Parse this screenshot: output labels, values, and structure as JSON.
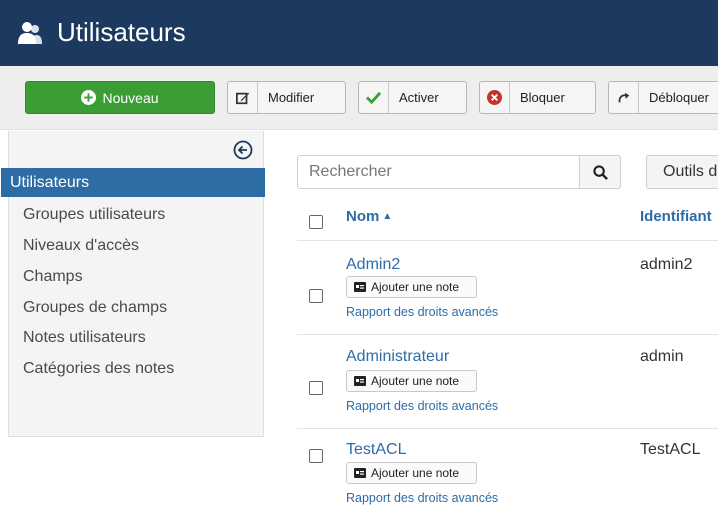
{
  "header": {
    "title": "Utilisateurs",
    "icon": "users-icon",
    "bg_color": "#1c3a5f"
  },
  "toolbar": {
    "new_label": "Nouveau",
    "edit_label": "Modifier",
    "activate_label": "Activer",
    "block_label": "Bloquer",
    "unblock_label": "Débloquer"
  },
  "sidebar": {
    "items": [
      {
        "label": "Utilisateurs",
        "active": true
      },
      {
        "label": "Groupes utilisateurs"
      },
      {
        "label": "Niveaux d'accès"
      },
      {
        "label": "Champs"
      },
      {
        "label": "Groupes de champs"
      },
      {
        "label": "Notes utilisateurs"
      },
      {
        "label": "Catégories des notes"
      }
    ]
  },
  "search": {
    "placeholder": "Rechercher",
    "tools_label": "Outils de recherche"
  },
  "table": {
    "columns": {
      "name": "Nom",
      "login": "Identifiant"
    },
    "rows": [
      {
        "name": "Admin2",
        "login": "admin2",
        "note": "Ajouter une note",
        "report": "Rapport des droits avancés"
      },
      {
        "name": "Administrateur",
        "login": "admin",
        "note": "Ajouter une note",
        "report": "Rapport des droits avancés"
      },
      {
        "name": "TestACL",
        "login": "TestACL",
        "note": "Ajouter une note",
        "report": "Rapport des droits avancés"
      }
    ]
  },
  "colors": {
    "accent": "#2d6ca5",
    "new_button": "#3b9e35",
    "activate_check": "#3a9c35",
    "block_icon": "#c9302c"
  }
}
